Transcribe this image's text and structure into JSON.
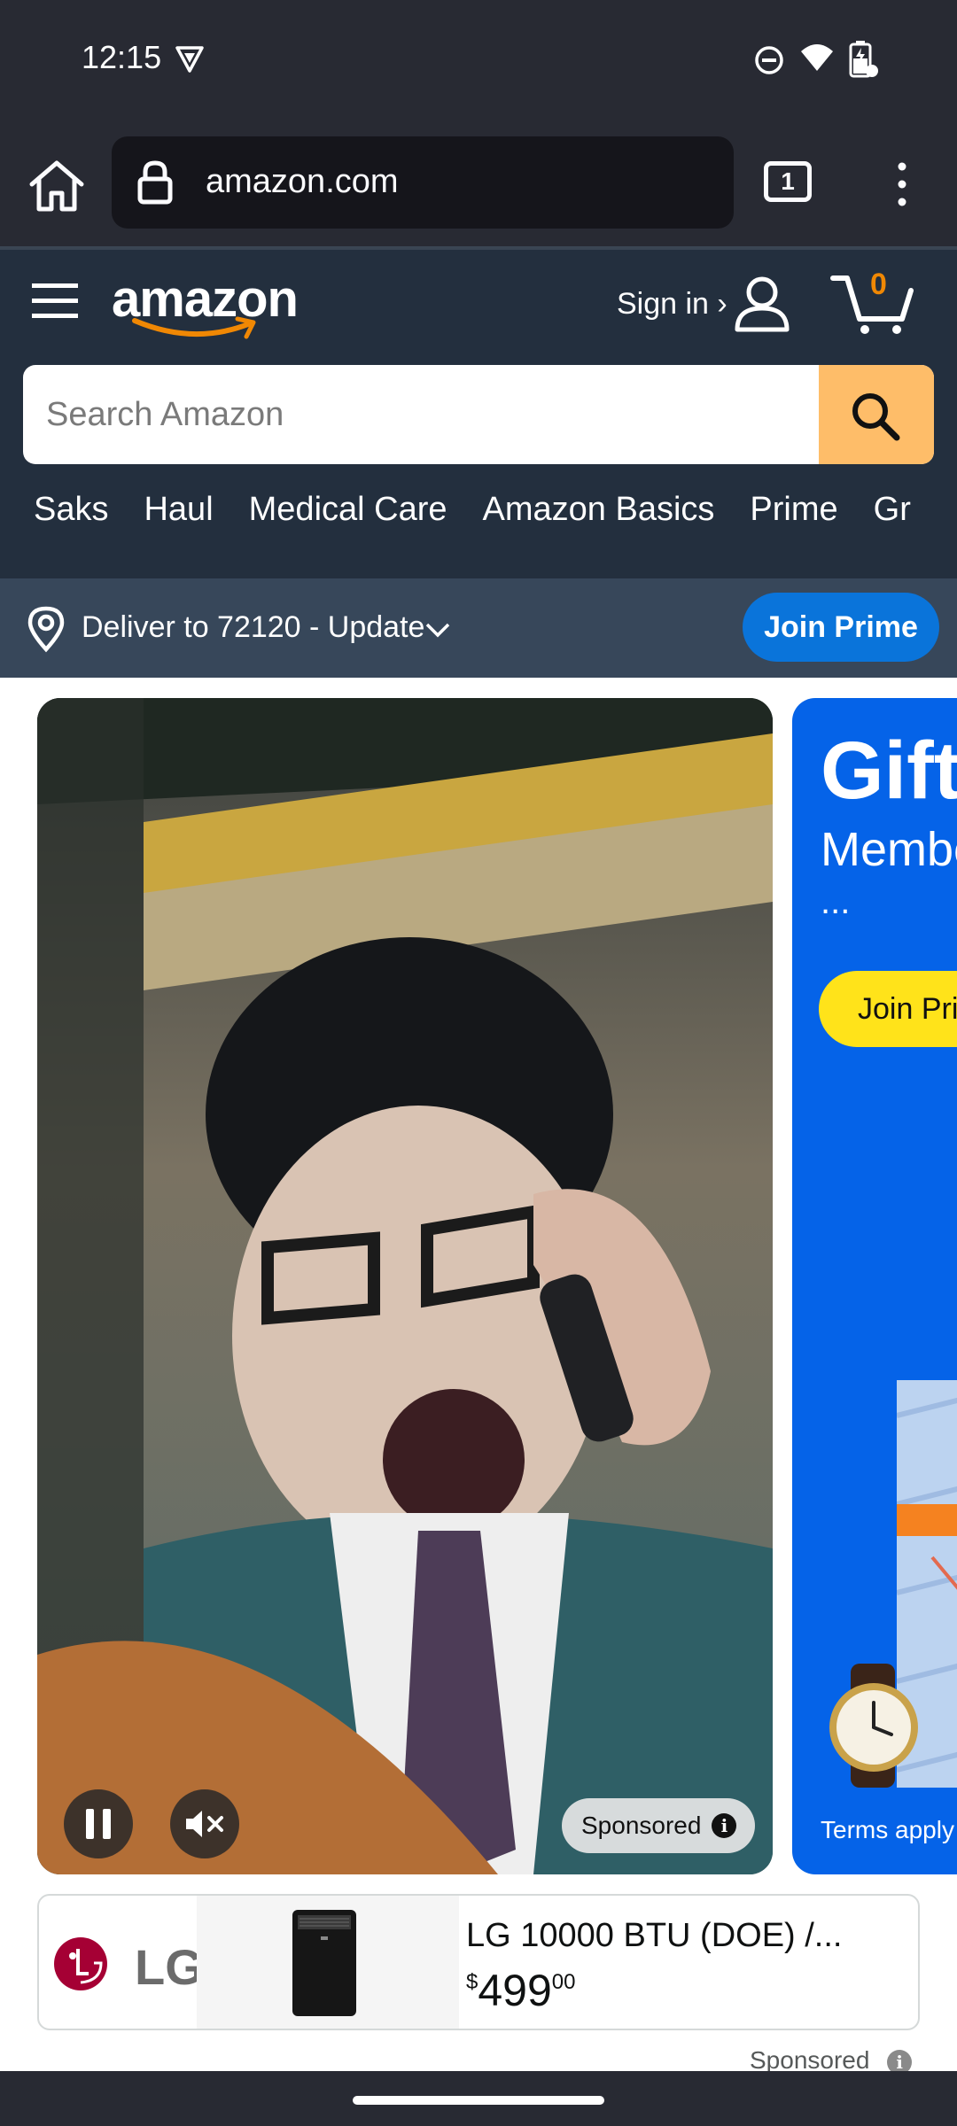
{
  "status_bar": {
    "time": "12:15"
  },
  "browser": {
    "url": "amazon.com",
    "tab_count": "1"
  },
  "header": {
    "logo": "amazon",
    "sign_in": "Sign in ›",
    "cart_count": "0",
    "search_placeholder": "Search Amazon",
    "nav_links": [
      "Saks",
      "Haul",
      "Medical Care",
      "Amazon Basics",
      "Prime",
      "Gr"
    ]
  },
  "delivery": {
    "text": "Deliver to 72120 - Update",
    "join_prime": "Join Prime"
  },
  "carousel": {
    "video_sponsored": "Sponsored",
    "gift_title": "Gift",
    "gift_subtitle": "Membe",
    "gift_ellipsis": "...",
    "gift_button": "Join Pri",
    "gift_terms": "Terms apply"
  },
  "product_ad": {
    "brand": "LG",
    "title": "LG 10000 BTU (DOE) /...",
    "price_symbol": "$",
    "price_whole": "499",
    "price_fraction": "00"
  },
  "footer": {
    "sponsored": "Sponsored"
  },
  "colors": {
    "amazon_dark": "#232f3e",
    "delivery_bar": "#37475a",
    "search_button": "#febd69",
    "prime_blue": "#0a74da",
    "cart_orange": "#f08804"
  }
}
